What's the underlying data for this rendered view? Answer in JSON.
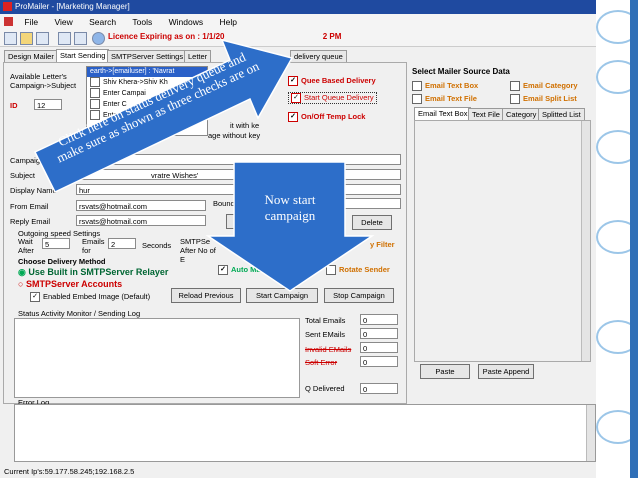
{
  "window": {
    "title": "ProMailer - [Marketing Manager]",
    "status": "Current Ip's:59.177.58.245;192.168.2.5"
  },
  "menu": [
    "File",
    "View",
    "Search",
    "Tools",
    "Windows",
    "Help"
  ],
  "toolbar": {
    "licence": "Licence Expiring as on : 1/1/20",
    "licence_tail": "2 PM"
  },
  "tabs": [
    "Design Mailer",
    "Start Sending",
    "SMTPServer Settings",
    "Letter",
    "delivery queue"
  ],
  "left": {
    "available_label": "Available Letter's Campaign->Subject",
    "id_label": "ID",
    "id_value": "12",
    "list_items": [
      "earth->[emailuser] : 'Navrat",
      "Shiv Khera->Shiv Kh",
      "Enter Campai",
      "Enter C",
      "Enter"
    ],
    "list_note_1": "it with ke",
    "list_note_2": "age without key",
    "queue_based": "Quee Based Delivery",
    "start_queue": "Start Queue Delivery",
    "on_off_temp": "On/Off Temp Lock",
    "campaign_label": "Campaign",
    "subject_label": "Subject",
    "subject_value": "vratre Wishes'",
    "display_name_label": "Display Name",
    "display_name_value": "hur",
    "from_email_label": "From Email",
    "from_email_value": "rsvats@hotmail.com",
    "bounce_label": "Bounc",
    "reply_email_label": "Reply Email",
    "reply_email_value": "rsvats@hotmail.com",
    "delete_label": "Delete",
    "speed_legend": "Outgoing speed Settings",
    "wait_label": "Wait After",
    "wait_value": "5",
    "emails_label": "Emails for",
    "emails_value": "2",
    "seconds_label": "Seconds",
    "smtp_after": "SMTPSe After No of E",
    "filter_label": "y Filter",
    "delivery_method_title": "Choose Delivery Method",
    "use_built_in": "Use Built in SMTPServer Relayer",
    "smtp_accounts": "SMTPServer Accounts",
    "auto_label": "Auto Ma",
    "rotate_sender": "Rotate Sender",
    "embed_image": "Enabled Embed Image (Default)",
    "reload_btn": "Reload Previous",
    "start_btn": "Start Campaign",
    "stop_btn": "Stop Campaign",
    "status_monitor": "Status Activity Monitor / Sending Log",
    "total_emails_label": "Total Emails",
    "total_emails_value": "0",
    "sent_emails_label": "Sent EMails",
    "sent_emails_value": "0",
    "invalid_label": "Invalid EMails",
    "invalid_value": "0",
    "soft_error_label": "Soft Error",
    "soft_error_value": "0",
    "q_delivered_label": "Q Delivered",
    "q_delivered_value": "0",
    "error_log": "Error Log"
  },
  "right": {
    "source_title": "Select Mailer Source Data",
    "email_text_box": "Email Text Box",
    "email_category": "Email Category",
    "email_text_file": "Email Text File",
    "email_split_list": "Email Split List",
    "subtabs": [
      "Email Text Box",
      "Text File",
      "Category",
      "Splitted List"
    ],
    "paste_btn": "Paste",
    "paste_append_btn": "Paste Append"
  },
  "callouts": {
    "arrow1": "Click here on status delivery queue and make sure as shown as three checks are on",
    "arrow2": "Now start campaign"
  },
  "colors": {
    "arrow": "#2d6ec9",
    "title_bar": "#1f4aa0",
    "red_text": "#cc0000"
  }
}
